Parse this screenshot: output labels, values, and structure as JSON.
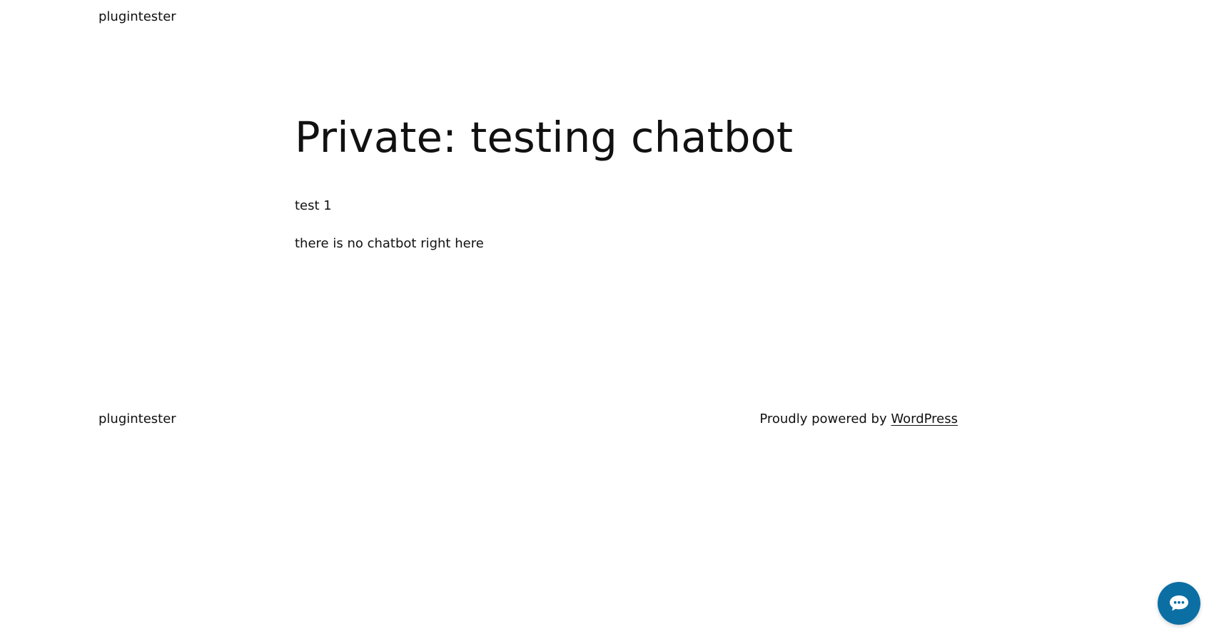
{
  "header": {
    "site_title": "plugintester"
  },
  "main": {
    "title": "Private: testing chatbot",
    "paragraphs": [
      "test 1",
      "there is no chatbot right here"
    ]
  },
  "footer": {
    "site_title": "plugintester",
    "credit_prefix": "Proudly powered by ",
    "credit_link": "WordPress"
  },
  "chat_widget": {
    "icon": "chat-bubble-icon",
    "color": "#0b6fa4"
  }
}
